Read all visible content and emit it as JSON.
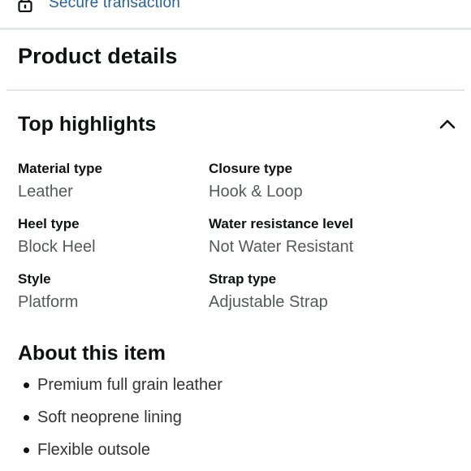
{
  "secure": {
    "label": "Secure transaction",
    "icon": "lock-icon",
    "color": "#2162a1"
  },
  "product_details": {
    "title": "Product details"
  },
  "top_highlights": {
    "title": "Top highlights",
    "expanded": true,
    "toggle_icon": "chevron-up-icon",
    "specs": [
      {
        "label": "Material type",
        "value": "Leather"
      },
      {
        "label": "Closure type",
        "value": "Hook & Loop"
      },
      {
        "label": "Heel type",
        "value": "Block Heel"
      },
      {
        "label": "Water resistance level",
        "value": "Not Water Resistant"
      },
      {
        "label": "Style",
        "value": "Platform"
      },
      {
        "label": "Strap type",
        "value": "Adjustable Strap"
      }
    ]
  },
  "about": {
    "title": "About this item",
    "items": [
      "Premium full grain leather",
      "Soft neoprene lining",
      "Flexible outsole"
    ]
  }
}
